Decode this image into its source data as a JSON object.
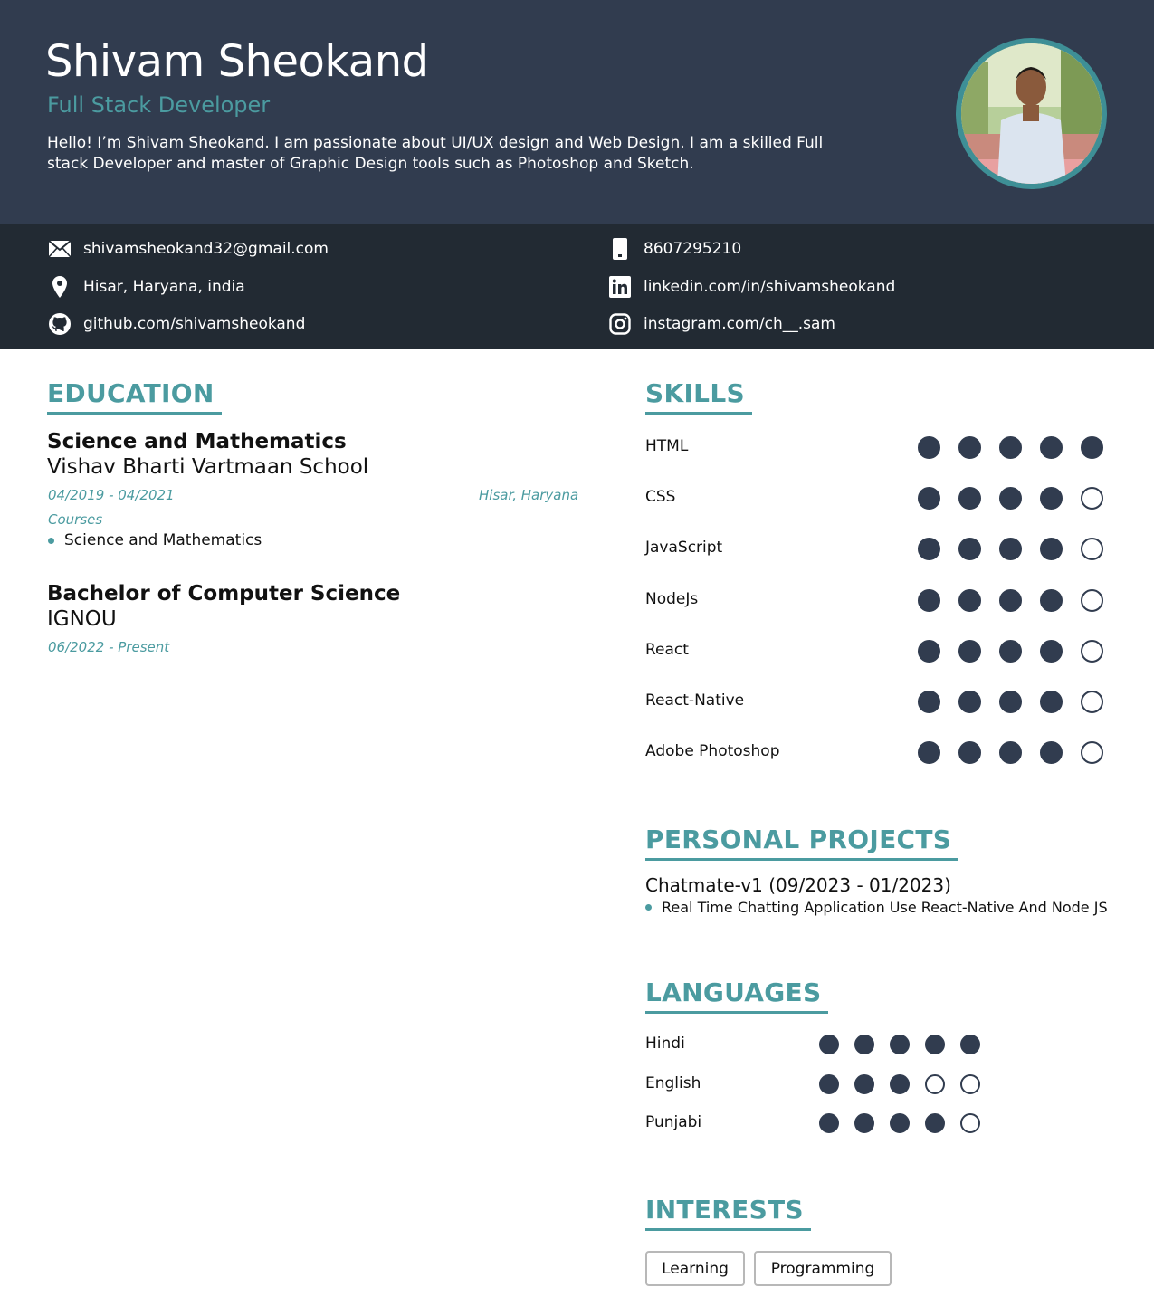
{
  "header": {
    "name": "Shivam Sheokand",
    "role": "Full Stack Developer",
    "summary": "Hello! I’m Shivam Sheokand. I am passionate about UI/UX design and Web Design. I am a skilled Full stack Developer and master of Graphic Design tools such as Photoshop and Sketch."
  },
  "contact": {
    "email": "shivamsheokand32@gmail.com",
    "phone": "8607295210",
    "location": "Hisar, Haryana, india",
    "linkedin": "linkedin.com/in/shivamsheokand",
    "github": "github.com/shivamsheokand",
    "instagram": "instagram.com/ch__.sam"
  },
  "education": {
    "heading": "EDUCATION",
    "entries": [
      {
        "degree": "Science and Mathematics",
        "school": "Vishav Bharti Vartmaan School",
        "dates": "04/2019 - 04/2021",
        "location": "Hisar, Haryana",
        "courses_label": "Courses",
        "courses": [
          "Science and Mathematics"
        ]
      },
      {
        "degree": "Bachelor of Computer Science",
        "school": "IGNOU",
        "dates": "06/2022 - Present"
      }
    ]
  },
  "skills": {
    "heading": "SKILLS",
    "items": [
      {
        "name": "HTML",
        "level": 5
      },
      {
        "name": "CSS",
        "level": 4
      },
      {
        "name": "JavaScript",
        "level": 4
      },
      {
        "name": "NodeJs",
        "level": 4
      },
      {
        "name": "React",
        "level": 4
      },
      {
        "name": "React-Native",
        "level": 4
      },
      {
        "name": "Adobe Photoshop",
        "level": 4
      }
    ],
    "max_level": 5
  },
  "projects": {
    "heading": "PERSONAL PROJECTS",
    "items": [
      {
        "title": "Chatmate-v1 (09/2023 - 01/2023)",
        "bullets": [
          "Real Time Chatting Application Use React-Native And Node JS"
        ]
      }
    ]
  },
  "languages": {
    "heading": "LANGUAGES",
    "items": [
      {
        "name": "Hindi",
        "level": 5
      },
      {
        "name": "English",
        "level": 3
      },
      {
        "name": "Punjabi",
        "level": 4
      }
    ],
    "max_level": 5
  },
  "interests": {
    "heading": "INTERESTS",
    "items": [
      "Learning",
      "Programming"
    ]
  },
  "colors": {
    "header_bg": "#313c4f",
    "contact_bg": "#222a33",
    "accent": "#4b9ba0",
    "dot": "#313c4f"
  }
}
